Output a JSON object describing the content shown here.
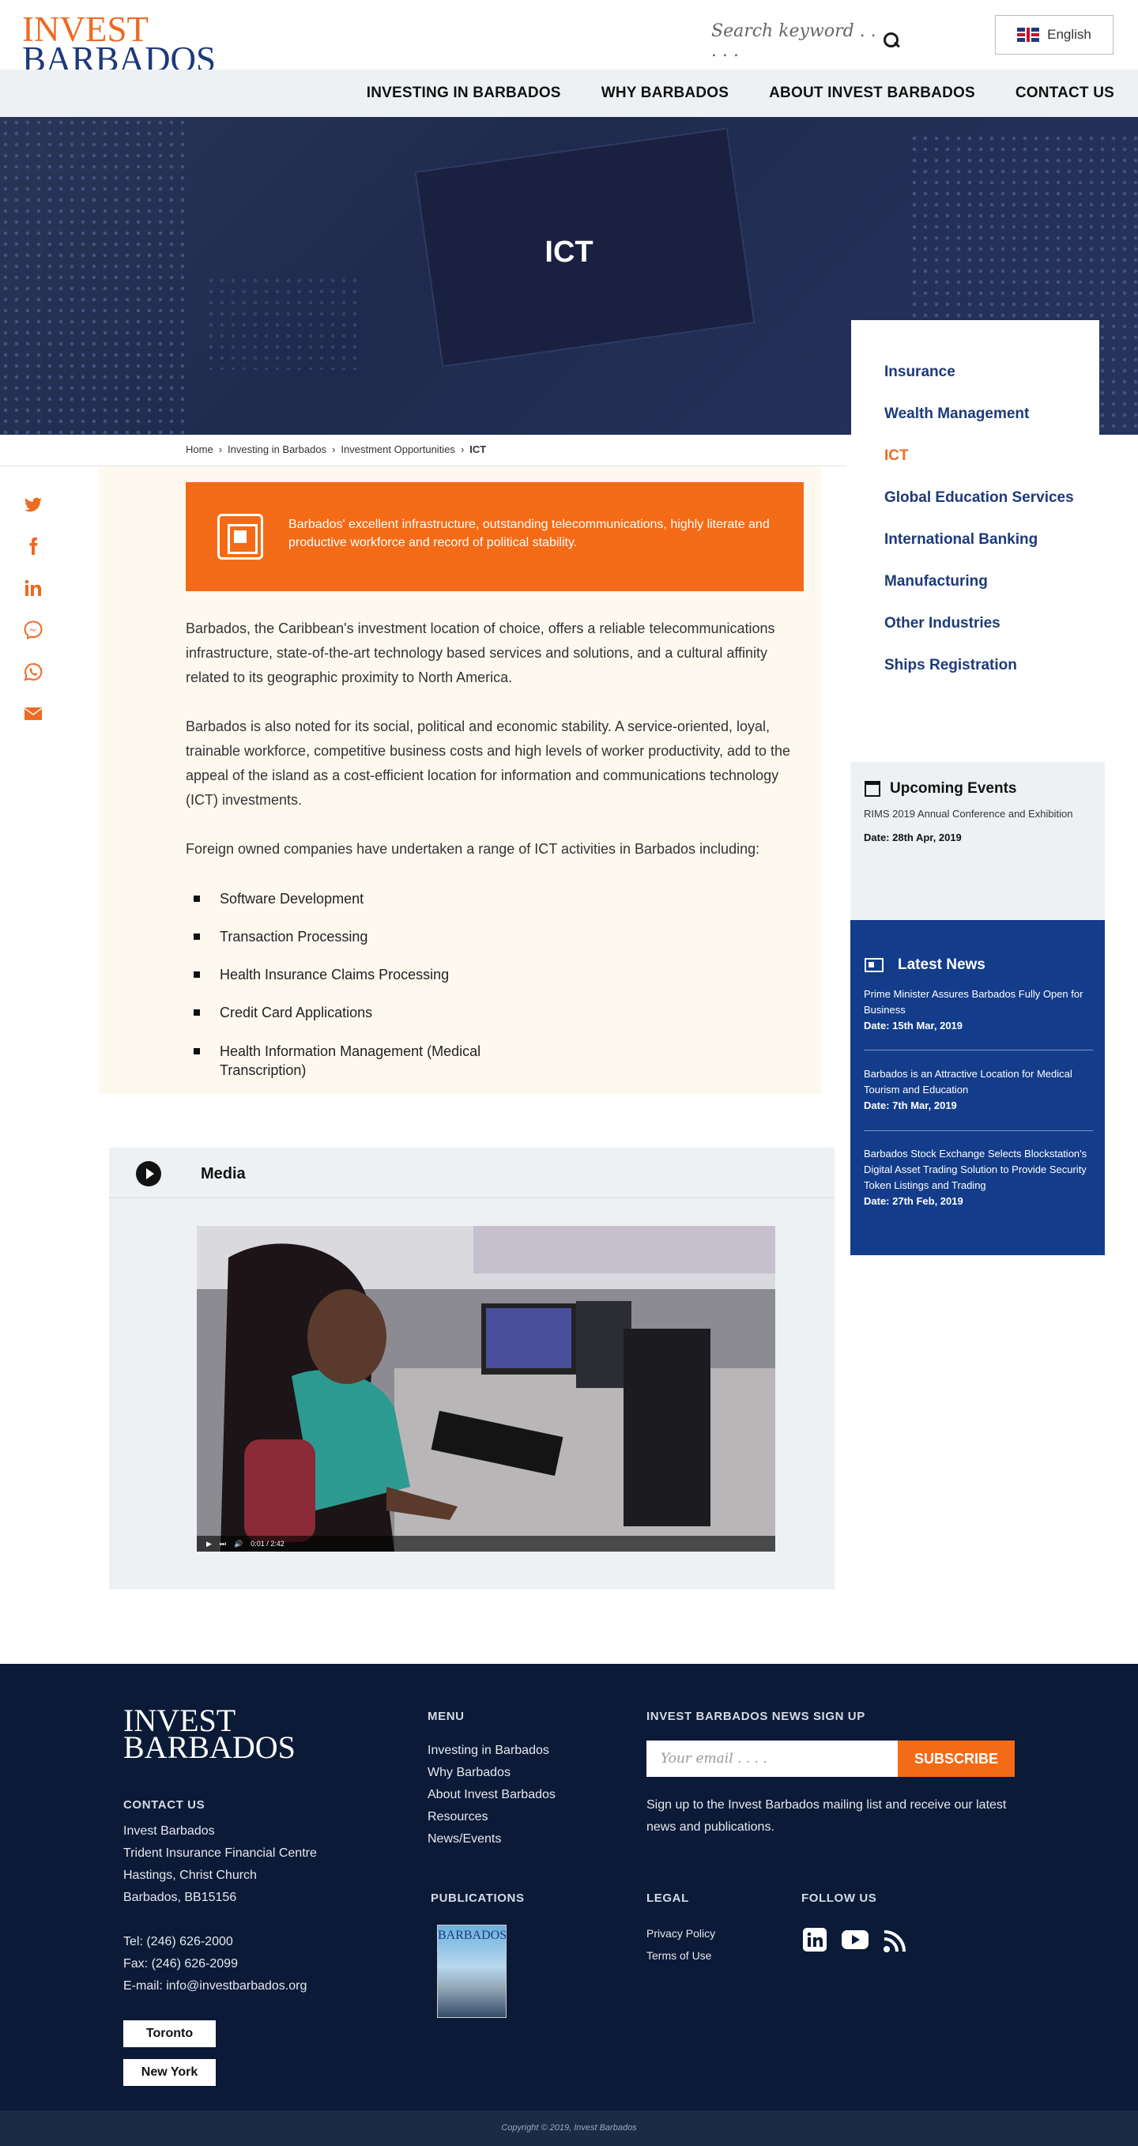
{
  "header": {
    "logo_line1": "INVEST",
    "logo_line2": "BARBADOS",
    "search_placeholder": "Search keyword . . . . .",
    "language": "English"
  },
  "nav": [
    "INVESTING IN BARBADOS",
    "WHY BARBADOS",
    "ABOUT INVEST BARBADOS",
    "CONTACT US"
  ],
  "hero": {
    "title": "ICT"
  },
  "breadcrumb": [
    "Home",
    "Investing in Barbados",
    "Investment Opportunities",
    "ICT"
  ],
  "side_menu": {
    "items": [
      "Insurance",
      "Wealth Management",
      "ICT",
      "Global Education Services",
      "International Banking",
      "Manufacturing",
      "Other Industries",
      "Ships Registration"
    ],
    "active": "ICT"
  },
  "highlight": "Barbados' excellent infrastructure, outstanding telecommunications, highly literate and productive workforce and record of political stability.",
  "paragraphs": [
    "Barbados, the Caribbean's investment location of choice, offers a reliable telecommunications infrastructure, state-of-the-art technology based services and solutions, and a cultural affinity related to its geographic proximity to North America.",
    "Barbados is also noted for its social, political and economic stability. A service-oriented, loyal, trainable workforce, competitive business costs and high levels of worker productivity, add to the appeal of the island as a cost-efficient location for information and communications technology (ICT) investments.",
    "Foreign owned companies have undertaken a range of ICT activities in Barbados including:"
  ],
  "activities": [
    "Software Development",
    "Transaction Processing",
    "Health Insurance Claims Processing",
    "Credit Card Applications",
    "Health Information Management (Medical Transcription)"
  ],
  "events": {
    "title": "Upcoming Events",
    "item": "RIMS 2019 Annual Conference and Exhibition",
    "date": "Date: 28th Apr, 2019"
  },
  "news": {
    "title": "Latest News",
    "items": [
      {
        "title": "Prime Minister Assures Barbados Fully Open for Business",
        "date": "Date: 15th Mar, 2019"
      },
      {
        "title": "Barbados is an Attractive Location for Medical Tourism and Education",
        "date": "Date: 7th Mar, 2019"
      },
      {
        "title": "Barbados Stock Exchange Selects Blockstation's Digital Asset Trading Solution to Provide Security Token Listings and Trading",
        "date": "Date: 27th Feb, 2019"
      }
    ]
  },
  "media": {
    "title": "Media",
    "time": "0:01 / 2:42"
  },
  "footer": {
    "logo_line1": "INVEST",
    "logo_line2": "BARBADOS",
    "contact_heading": "CONTACT US",
    "address": [
      "Invest Barbados",
      "Trident Insurance Financial Centre",
      "Hastings, Christ Church",
      "Barbados, BB15156"
    ],
    "phones": [
      "Tel: (246) 626-2000",
      "Fax: (246) 626-2099",
      "E-mail: info@investbarbados.org"
    ],
    "offices": [
      "Toronto",
      "New York"
    ],
    "menu_heading": "MENU",
    "menu": [
      "Investing in Barbados",
      "Why Barbados",
      "About Invest Barbados",
      "Resources",
      "News/Events"
    ],
    "signup_heading": "INVEST BARBADOS NEWS SIGN UP",
    "email_placeholder": "Your email . . . .",
    "subscribe": "SUBSCRIBE",
    "signup_text": "Sign up to the Invest Barbados mailing list and receive our latest  news and publications.",
    "publications_heading": "PUBLICATIONS",
    "publication_cover_title": "BARBADOS",
    "legal_heading": "LEGAL",
    "legal": [
      "Privacy Policy",
      "Terms of Use"
    ],
    "follow_heading": "FOLLOW US",
    "copyright": "Copyright © 2019, Invest Barbados"
  },
  "colors": {
    "accent": "#ef6a22",
    "navy": "#1d3a7a",
    "news_bg": "#133c8a",
    "footer_bg": "#0b1a36"
  },
  "icons": [
    "twitter-icon",
    "facebook-icon",
    "linkedin-icon",
    "messenger-icon",
    "whatsapp-icon",
    "email-icon",
    "search-icon",
    "play-icon",
    "calendar-icon",
    "newspaper-icon",
    "youtube-icon",
    "rss-icon"
  ]
}
